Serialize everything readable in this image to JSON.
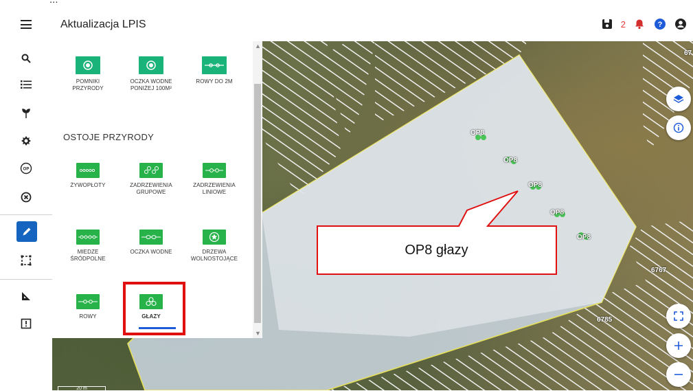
{
  "header": {
    "title": "Aktualizacja LPIS",
    "notification_count": "2"
  },
  "top_cut_text": "...",
  "panel": {
    "legacy_items": [
      {
        "label": "POMNIKI PRZYRODY"
      },
      {
        "label": "OCZKA WODNE PONIŻEJ 100M²"
      },
      {
        "label": "ROWY DO 2M"
      }
    ],
    "section_title": "OSTOJE PRZYRODY",
    "items": [
      {
        "label": "ŻYWOPŁOTY"
      },
      {
        "label": "ZADRZEWIENIA GRUPOWE"
      },
      {
        "label": "ZADRZEWIENIA LINIOWE"
      },
      {
        "label": "MIEDZE ŚRÓDPOLNE"
      },
      {
        "label": "OCZKA WODNE"
      },
      {
        "label": "DRZEWA WOLNOSTOJĄCE"
      },
      {
        "label": "ROWY"
      },
      {
        "label": "GŁAZY"
      }
    ]
  },
  "map": {
    "parcel_numbers": [
      "67",
      "6767",
      "6785"
    ],
    "markers": [
      "OP8",
      "OP8",
      "OP8",
      "OP8",
      "OP8"
    ],
    "scale": "20 m"
  },
  "callout": {
    "text": "OP8 głazy"
  },
  "colors": {
    "accent": "#1565c0",
    "symbol_green": "#27b24a",
    "highlight_red": "#e01010",
    "parcel_outline": "#e6e05a"
  }
}
